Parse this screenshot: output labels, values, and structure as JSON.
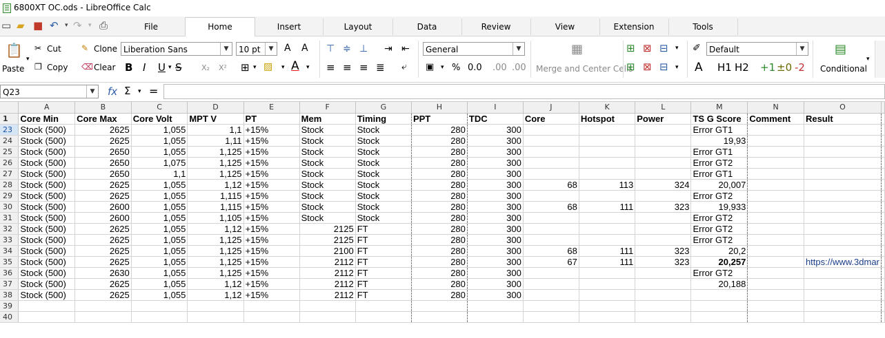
{
  "window": {
    "title": "6800XT OC.ods - LibreOffice Calc"
  },
  "menu": {
    "tabs": [
      "File",
      "Home",
      "Insert",
      "Layout",
      "Data",
      "Review",
      "View",
      "Extension",
      "Tools"
    ],
    "active": "Home"
  },
  "toolbar": {
    "paste": "Paste",
    "cut": "Cut",
    "copy": "Copy",
    "clone": "Clone",
    "clear": "Clear",
    "font_name": "Liberation Sans",
    "font_size": "10 pt",
    "number_format": "General",
    "merge": "Merge and Center Cells",
    "style": "Default",
    "conditional": "Conditional",
    "bold": "B",
    "italic": "I",
    "underline": "U",
    "strike": "S",
    "subscript": "X₂",
    "superscript": "X²",
    "grow": "A^",
    "shrink": "A˅",
    "percent": "%",
    "decimals": "0.0",
    "add_dec": ".00",
    "del_dec": ".00",
    "h1": "H1",
    "h2": "H2",
    "p1": "+1",
    "z0": "±0",
    "m2": "-2",
    "style_a": "A"
  },
  "formula": {
    "cell_ref": "Q23",
    "fx": "fx",
    "sum": "Σ",
    "equals": "=",
    "value": ""
  },
  "sheet": {
    "columns": [
      "A",
      "B",
      "C",
      "D",
      "E",
      "F",
      "G",
      "H",
      "I",
      "J",
      "K",
      "L",
      "M",
      "N",
      "O"
    ],
    "header_row": {
      "num": "1",
      "cells": [
        "Core Min",
        "Core Max",
        "Core Volt",
        "MPT V",
        "PT",
        "Mem",
        "Timing",
        "PPT",
        "TDC",
        "Core",
        "Hotspot",
        "Power",
        "TS G Score",
        "Comment",
        "Result"
      ]
    },
    "rows": [
      {
        "num": "23",
        "cells": [
          "Stock (500)",
          "2625",
          "1,055",
          "1,1",
          "+15%",
          "Stock",
          "Stock",
          "280",
          "300",
          "",
          "",
          "",
          "Error GT1",
          "",
          ""
        ]
      },
      {
        "num": "24",
        "cells": [
          "Stock (500)",
          "2625",
          "1,055",
          "1,11",
          "+15%",
          "Stock",
          "Stock",
          "280",
          "300",
          "",
          "",
          "",
          "19,93",
          "",
          ""
        ]
      },
      {
        "num": "25",
        "cells": [
          "Stock (500)",
          "2650",
          "1,055",
          "1,125",
          "+15%",
          "Stock",
          "Stock",
          "280",
          "300",
          "",
          "",
          "",
          "Error GT1",
          "",
          ""
        ]
      },
      {
        "num": "26",
        "cells": [
          "Stock (500)",
          "2650",
          "1,075",
          "1,125",
          "+15%",
          "Stock",
          "Stock",
          "280",
          "300",
          "",
          "",
          "",
          "Error GT2",
          "",
          ""
        ]
      },
      {
        "num": "27",
        "cells": [
          "Stock (500)",
          "2650",
          "1,1",
          "1,125",
          "+15%",
          "Stock",
          "Stock",
          "280",
          "300",
          "",
          "",
          "",
          "Error GT1",
          "",
          ""
        ]
      },
      {
        "num": "28",
        "cells": [
          "Stock (500)",
          "2625",
          "1,055",
          "1,12",
          "+15%",
          "Stock",
          "Stock",
          "280",
          "300",
          "68",
          "113",
          "324",
          "20,007",
          "",
          ""
        ]
      },
      {
        "num": "29",
        "cells": [
          "Stock (500)",
          "2625",
          "1,055",
          "1,115",
          "+15%",
          "Stock",
          "Stock",
          "280",
          "300",
          "",
          "",
          "",
          "Error GT2",
          "",
          ""
        ]
      },
      {
        "num": "30",
        "cells": [
          "Stock (500)",
          "2600",
          "1,055",
          "1,115",
          "+15%",
          "Stock",
          "Stock",
          "280",
          "300",
          "68",
          "111",
          "323",
          "19,933",
          "",
          ""
        ]
      },
      {
        "num": "31",
        "cells": [
          "Stock (500)",
          "2600",
          "1,055",
          "1,105",
          "+15%",
          "Stock",
          "Stock",
          "280",
          "300",
          "",
          "",
          "",
          "Error GT2",
          "",
          ""
        ]
      },
      {
        "num": "32",
        "cells": [
          "Stock (500)",
          "2625",
          "1,055",
          "1,12",
          "+15%",
          "2125",
          "FT",
          "280",
          "300",
          "",
          "",
          "",
          "Error GT2",
          "",
          ""
        ]
      },
      {
        "num": "33",
        "cells": [
          "Stock (500)",
          "2625",
          "1,055",
          "1,125",
          "+15%",
          "2125",
          "FT",
          "280",
          "300",
          "",
          "",
          "",
          "Error GT2",
          "",
          ""
        ]
      },
      {
        "num": "34",
        "cells": [
          "Stock (500)",
          "2625",
          "1,055",
          "1,125",
          "+15%",
          "2100",
          "FT",
          "280",
          "300",
          "68",
          "111",
          "323",
          "20,2",
          "",
          ""
        ]
      },
      {
        "num": "35",
        "cells": [
          "Stock (500)",
          "2625",
          "1,055",
          "1,125",
          "+15%",
          "2112",
          "FT",
          "280",
          "300",
          "67",
          "111",
          "323",
          "20,257",
          "",
          "https://www.3dmar"
        ]
      },
      {
        "num": "36",
        "cells": [
          "Stock (500)",
          "2630",
          "1,055",
          "1,125",
          "+15%",
          "2112",
          "FT",
          "280",
          "300",
          "",
          "",
          "",
          "Error GT2",
          "",
          ""
        ]
      },
      {
        "num": "37",
        "cells": [
          "Stock (500)",
          "2625",
          "1,055",
          "1,12",
          "+15%",
          "2112",
          "FT",
          "280",
          "300",
          "",
          "",
          "",
          "20,188",
          "",
          ""
        ]
      },
      {
        "num": "38",
        "cells": [
          "Stock (500)",
          "2625",
          "1,055",
          "1,12",
          "+15%",
          "2112",
          "FT",
          "280",
          "300",
          "",
          "",
          "",
          "",
          "",
          ""
        ]
      },
      {
        "num": "39",
        "cells": [
          "",
          "",
          "",
          "",
          "",
          "",
          "",
          "",
          "",
          "",
          "",
          "",
          "",
          "",
          ""
        ]
      },
      {
        "num": "40",
        "cells": [
          "",
          "",
          "",
          "",
          "",
          "",
          "",
          "",
          "",
          "",
          "",
          "",
          "",
          "",
          ""
        ]
      }
    ]
  }
}
